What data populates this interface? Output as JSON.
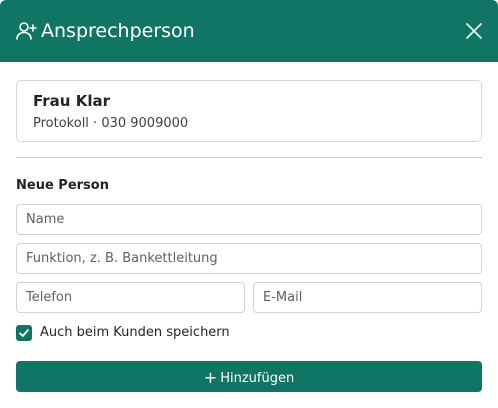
{
  "dialog": {
    "title": "Ansprechperson",
    "header_icon": "person-add-icon",
    "close_icon": "close-icon",
    "accent_color": "#117566"
  },
  "contact": {
    "name": "Frau Klar",
    "subtitle": "Protokoll · 030 9009000"
  },
  "new_person": {
    "heading": "Neue Person",
    "name_placeholder": "Name",
    "funktion_placeholder": "Funktion, z. B. Bankettleitung",
    "telefon_placeholder": "Telefon",
    "email_placeholder": "E-Mail",
    "save_to_customer_label": "Auch beim Kunden speichern",
    "save_to_customer_checked": true,
    "add_button_label": "Hinzufügen",
    "add_icon": "plus-icon"
  }
}
